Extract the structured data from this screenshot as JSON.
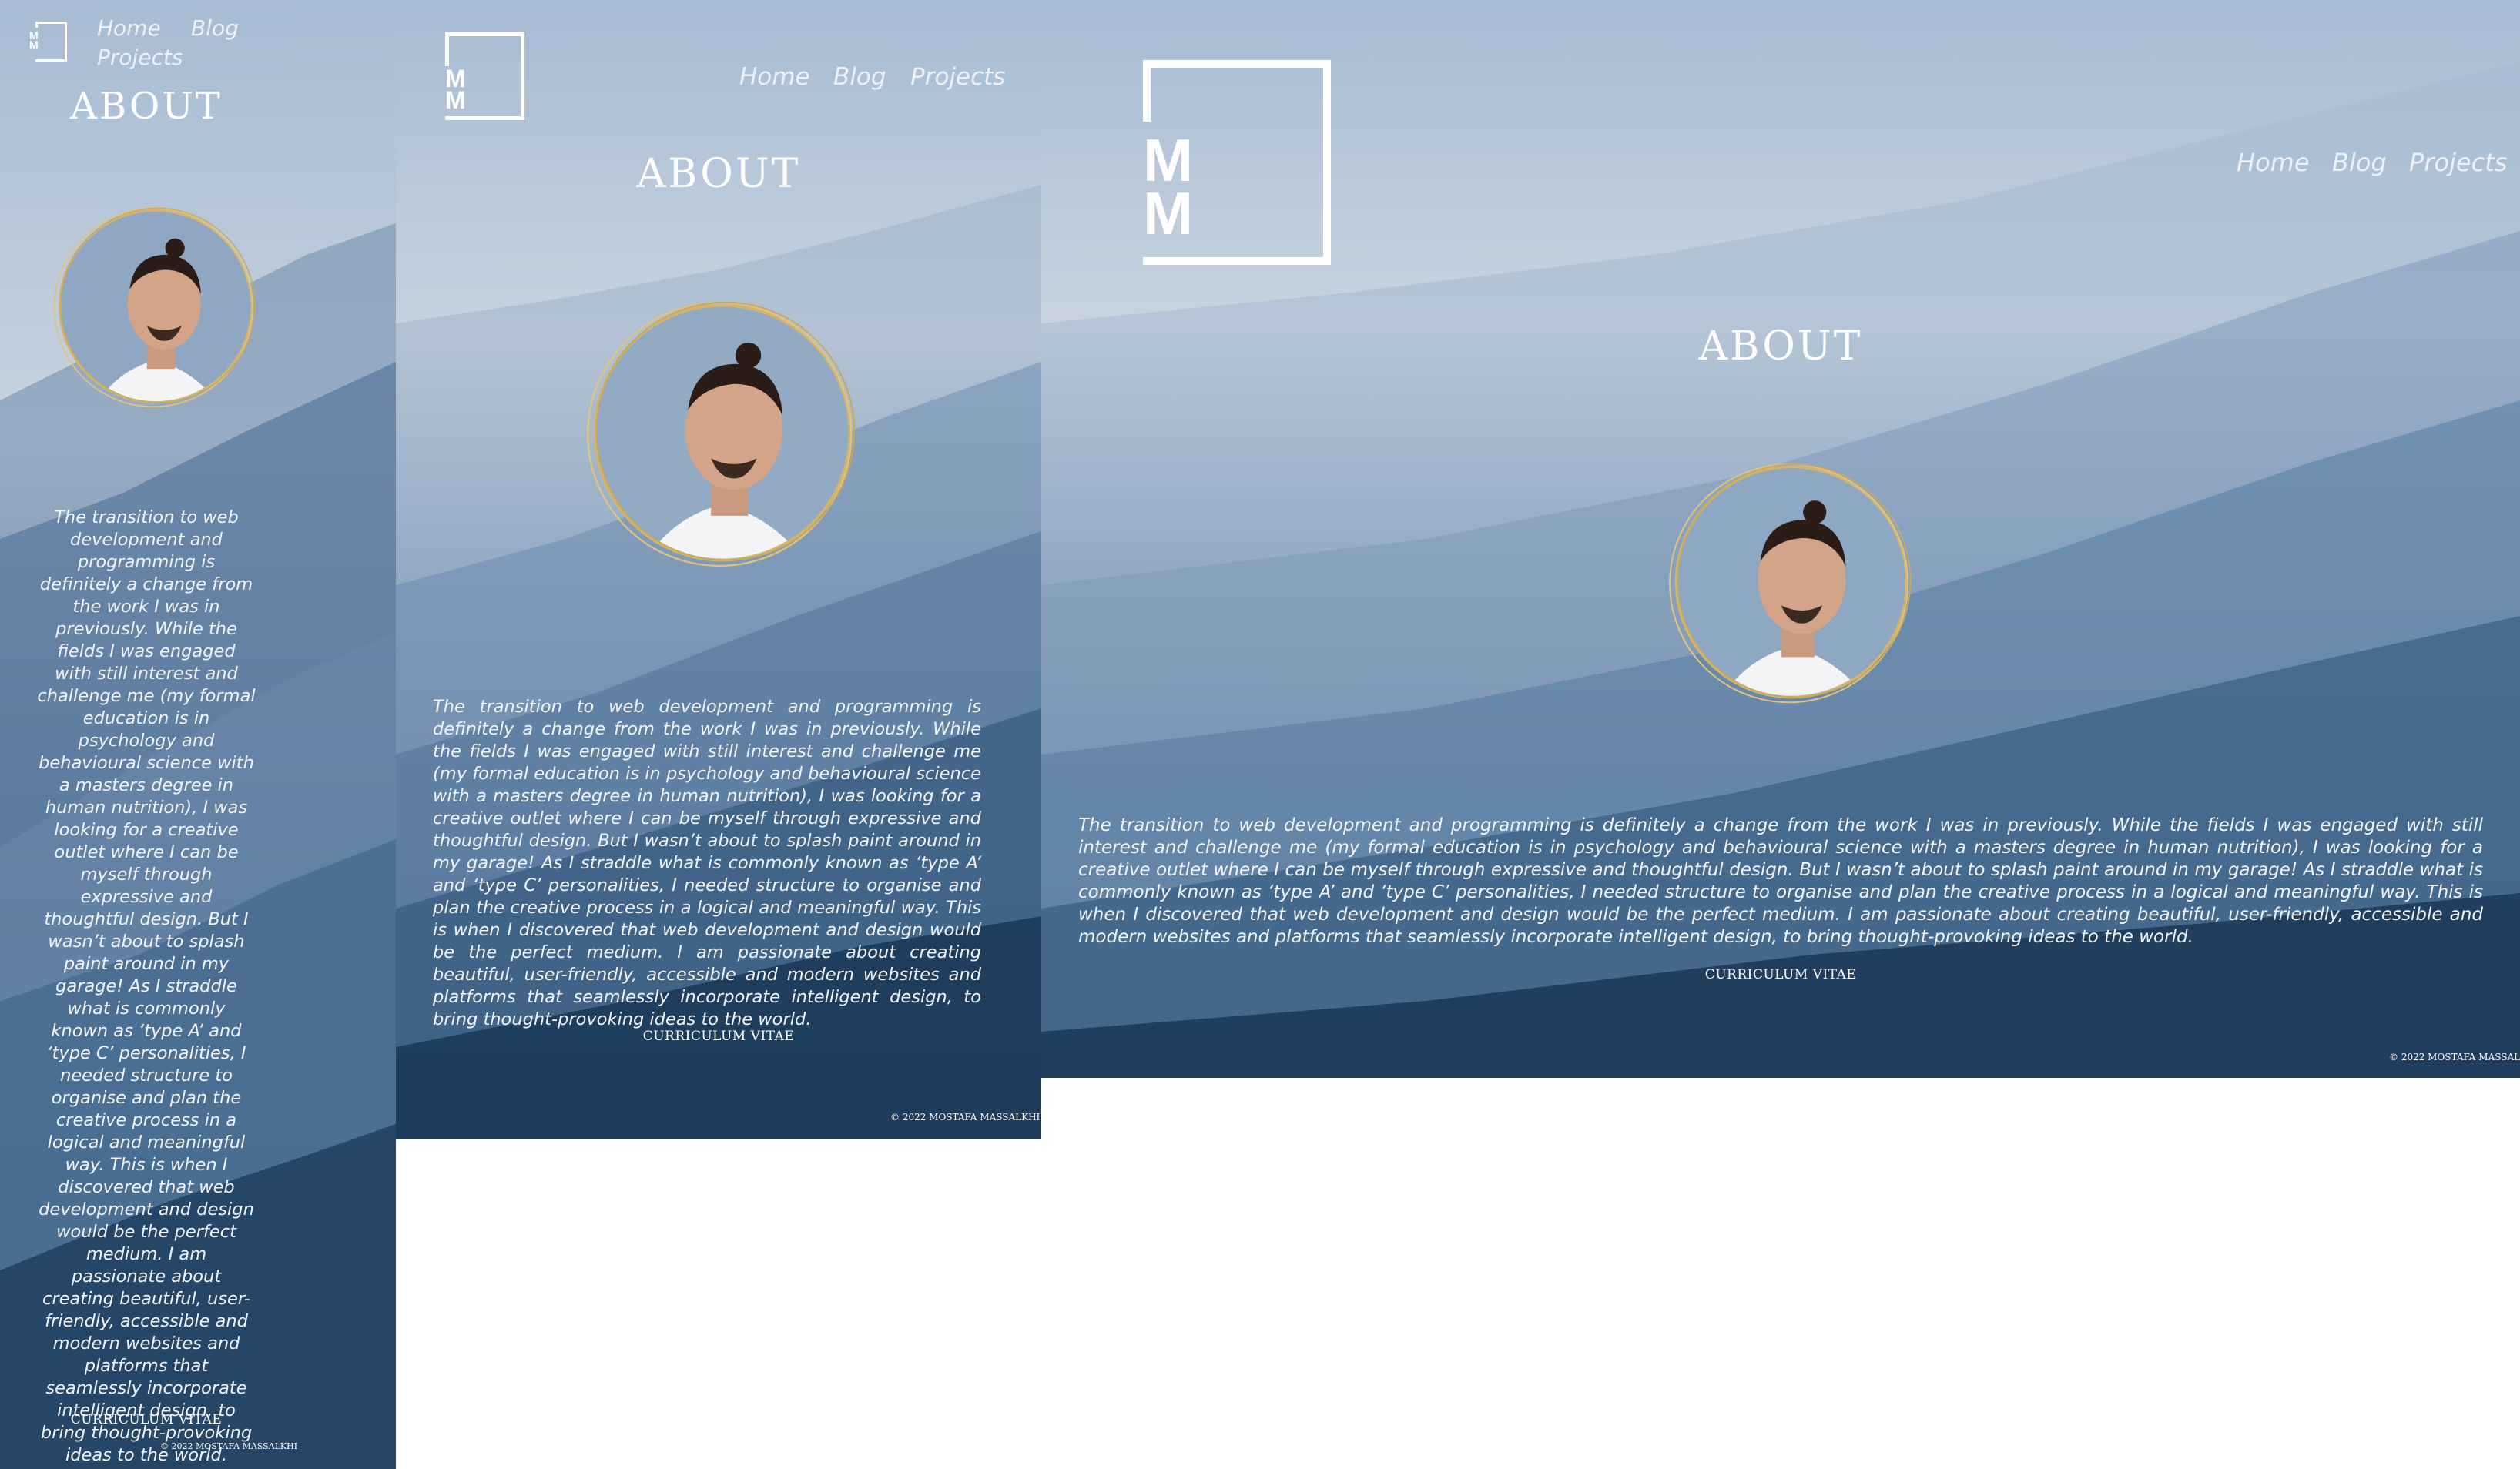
{
  "site": {
    "logo_text": "MM",
    "nav": {
      "home": "Home",
      "blog": "Blog",
      "projects": "Projects"
    },
    "page_title": "ABOUT",
    "bio": "The transition to web development and programming is definitely a change from the work I was in previously. While the fields I was engaged with still interest and challenge me (my formal education is in psychology and behavioural science with a masters degree in human nutrition), I was looking for a creative outlet where I can be myself through expressive and thoughtful design. But I wasn’t about to splash paint around in my garage! As I straddle what is commonly known as ‘type A’ and ‘type C’ personalities, I needed structure to organise and plan the creative process in a logical and meaningful way. This is when I discovered that web development and design would be the perfect medium. I am passionate about creating beautiful, user-friendly, accessible and modern websites and platforms that seamlessly incorporate intelligent design, to bring thought-provoking ideas to the world.",
    "cv_label": "CURRICULUM VITAE",
    "copyright": "© 2022 MOSTAFA MASSALKHI"
  },
  "viewports": [
    {
      "id": "mobile"
    },
    {
      "id": "tablet"
    },
    {
      "id": "desktop"
    }
  ],
  "colors": {
    "sky_top": "#a7bbd3",
    "sky_haze": "#c8d3df",
    "mountain_mid": "#7e98b6",
    "mountain_deep": "#0f2b46",
    "portrait_ring": "#d4b46a",
    "text": "#ffffff"
  }
}
